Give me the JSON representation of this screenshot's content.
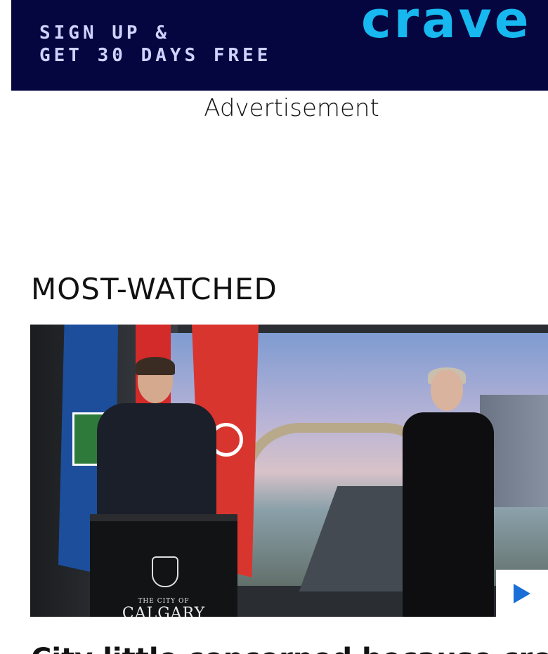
{
  "ad": {
    "line1": "SIGN UP &",
    "line2": "GET 30 DAYS FREE",
    "brand": "crave",
    "caption": "Advertisement",
    "bg_color": "#05063f",
    "brand_color": "#17b8f0"
  },
  "section": {
    "title": "MOST-WATCHED"
  },
  "video": {
    "podium_small": "THE CITY OF",
    "podium_big": "CALGARY",
    "play_icon": "play-icon",
    "headline": "City little concerned because crowds"
  }
}
